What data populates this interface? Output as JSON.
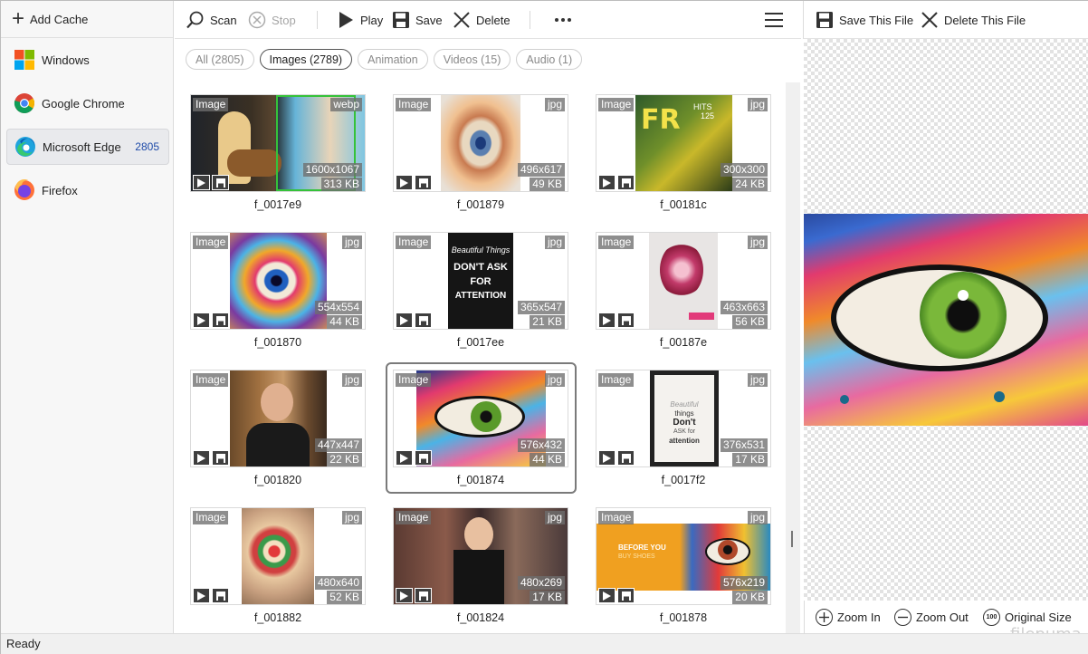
{
  "sidebar": {
    "add_cache_label": "Add Cache",
    "browsers": [
      {
        "label": "Windows",
        "count": ""
      },
      {
        "label": "Google Chrome",
        "count": ""
      },
      {
        "label": "Microsoft Edge",
        "count": "2805"
      },
      {
        "label": "Firefox",
        "count": ""
      }
    ]
  },
  "toolbar": {
    "scan": "Scan",
    "stop": "Stop",
    "play": "Play",
    "save": "Save",
    "delete": "Delete"
  },
  "filters": [
    {
      "label": "All (2805)"
    },
    {
      "label": "Images (2789)"
    },
    {
      "label": "Animation"
    },
    {
      "label": "Videos (15)"
    },
    {
      "label": "Audio (1)"
    }
  ],
  "grid": {
    "items": [
      {
        "type": "Image",
        "ext": "webp",
        "dims": "1600x1067",
        "size": "313 KB",
        "name": "f_0017e9"
      },
      {
        "type": "Image",
        "ext": "jpg",
        "dims": "496x617",
        "size": "49 KB",
        "name": "f_001879"
      },
      {
        "type": "Image",
        "ext": "jpg",
        "dims": "300x300",
        "size": "24 KB",
        "name": "f_00181c"
      },
      {
        "type": "Image",
        "ext": "jpg",
        "dims": "554x554",
        "size": "44 KB",
        "name": "f_001870"
      },
      {
        "type": "Image",
        "ext": "jpg",
        "dims": "365x547",
        "size": "21 KB",
        "name": "f_0017ee"
      },
      {
        "type": "Image",
        "ext": "jpg",
        "dims": "463x663",
        "size": "56 KB",
        "name": "f_00187e"
      },
      {
        "type": "Image",
        "ext": "jpg",
        "dims": "447x447",
        "size": "22 KB",
        "name": "f_001820"
      },
      {
        "type": "Image",
        "ext": "jpg",
        "dims": "576x432",
        "size": "44 KB",
        "name": "f_001874"
      },
      {
        "type": "Image",
        "ext": "jpg",
        "dims": "376x531",
        "size": "17 KB",
        "name": "f_0017f2"
      },
      {
        "type": "Image",
        "ext": "jpg",
        "dims": "480x640",
        "size": "52 KB",
        "name": "f_001882"
      },
      {
        "type": "Image",
        "ext": "jpg",
        "dims": "480x269",
        "size": "17 KB",
        "name": "f_001824"
      },
      {
        "type": "Image",
        "ext": "jpg",
        "dims": "576x219",
        "size": "20 KB",
        "name": "f_001878"
      }
    ],
    "thumb_text": {
      "hits": "HITS",
      "hits_number": "125",
      "beautiful_things": "Beautiful Things",
      "dont_ask": "DON'T ASK",
      "for": "FOR",
      "attention": "ATTENTION",
      "poster_line1": "Beautiful",
      "poster_line2": "things",
      "poster_line3": "Don't",
      "poster_line4": "ASK for",
      "poster_line5": "attention",
      "banner_line1": "BEFORE YOU",
      "banner_line2": "BUY SHOES"
    }
  },
  "preview": {
    "save_file": "Save This File",
    "delete_file": "Delete This File",
    "zoom_in": "Zoom In",
    "zoom_out": "Zoom Out",
    "original_size": "Original Size",
    "original_size_icon_text": "100"
  },
  "watermark": "filepuma",
  "status": "Ready",
  "colors": {
    "edge_count": "#1d4aa8",
    "selected_border": "#7a7a7a"
  }
}
